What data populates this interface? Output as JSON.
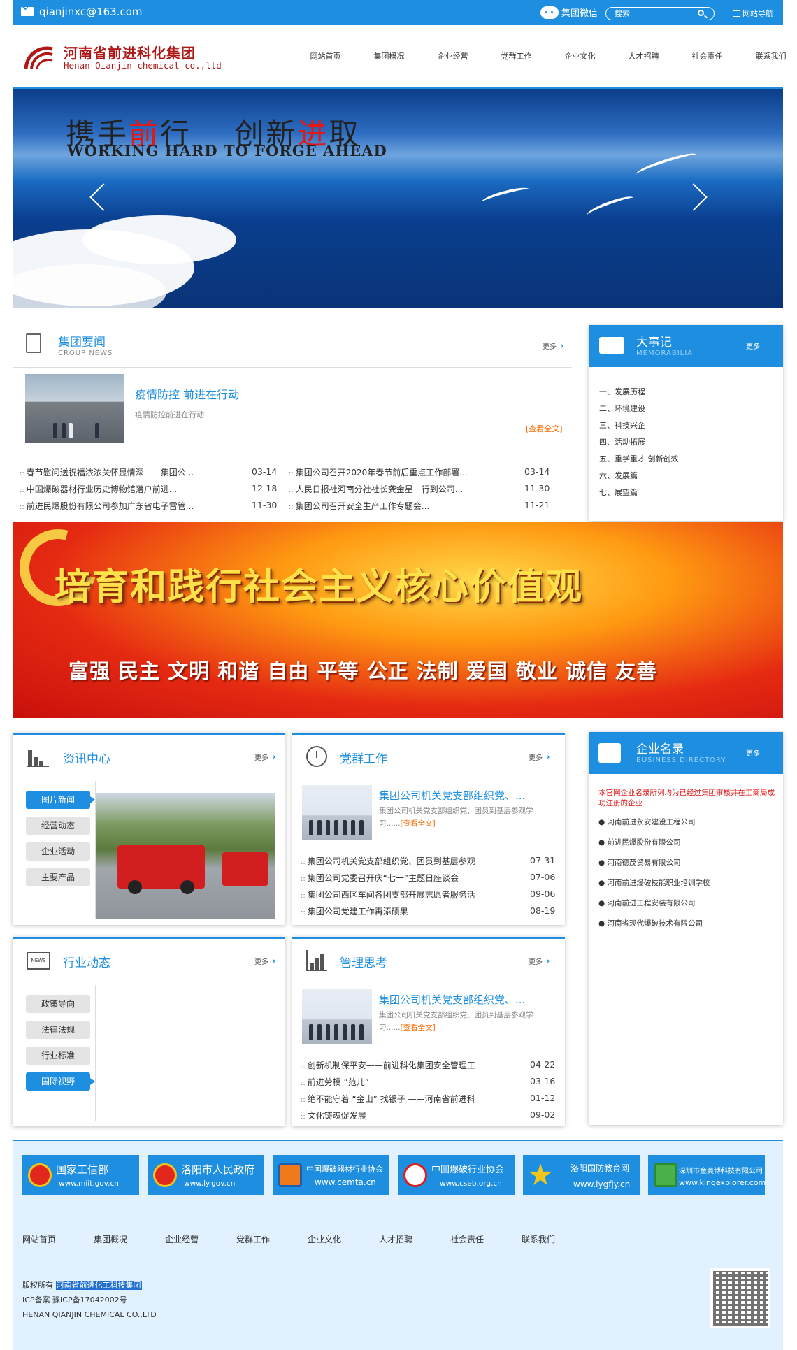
{
  "topbar": {
    "email": "qianjinxc@163.com",
    "wechat_label": "集团微信",
    "search_placeholder": "搜索",
    "site_nav": "网站导航"
  },
  "header": {
    "company_cn": "河南省前进科化集团",
    "company_en": "Henan Qianjin chemical co.,ltd",
    "nav": [
      "网站首页",
      "集团概况",
      "企业经营",
      "党群工作",
      "企业文化",
      "人才招聘",
      "社会责任",
      "联系我们"
    ]
  },
  "banner": {
    "slogan_a": "携手",
    "slogan_b": "前",
    "slogan_c": "行　 创新",
    "slogan_d": "进",
    "slogan_e": "取",
    "slogan_en": "WORKING HARD TO FORGE AHEAD"
  },
  "group_news": {
    "title": "集团要闻",
    "subtitle": "CROUP NEWS",
    "more": "更多",
    "featured_title": "疫情防控 前进在行动",
    "featured_desc": "疫情防控前进在行动",
    "read_all": "[查看全文]",
    "left_items": [
      {
        "text": "春节慰问送祝福浓浓关怀显情深——集团公...",
        "date": "03-14"
      },
      {
        "text": "中国爆破器材行业历史博物馆落户前进...",
        "date": "12-18"
      },
      {
        "text": "前进民爆股份有限公司参加广东省电子雷管...",
        "date": "11-30"
      }
    ],
    "right_items": [
      {
        "text": "集团公司召开2020年春节前后重点工作部署...",
        "date": "03-14"
      },
      {
        "text": "人民日报社河南分社社长龚金星一行到公司...",
        "date": "11-30"
      },
      {
        "text": "集团公司召开安全生产工作专题会...",
        "date": "11-21"
      }
    ]
  },
  "memorabilia": {
    "title": "大事记",
    "subtitle": "MEMORABILIA",
    "more": "更多",
    "items": [
      "一、发展历程",
      "二、环境建设",
      "三、科技兴企",
      "四、活动拓展",
      "五、重学重才 创新创效",
      "六、发展篇",
      "七、展望篇"
    ]
  },
  "values_banner": {
    "title": "培育和践行社会主义核心价值观",
    "values": "富强 民主 文明 和谐 自由 平等 公正 法制 爱国 敬业 诚信 友善"
  },
  "info_center": {
    "title": "资讯中心",
    "more": "更多",
    "tabs": [
      "图片新闻",
      "经营动态",
      "企业活动",
      "主要产品"
    ]
  },
  "party_work": {
    "title": "党群工作",
    "more": "更多",
    "featured_title": "集团公司机关党支部组织党、...",
    "featured_desc": "集团公司机关党支部组织党、团员到基层参观学习......",
    "read_all": "[查看全文]",
    "items": [
      {
        "text": "集团公司机关党支部组织党、团员到基层参观",
        "date": "07-31"
      },
      {
        "text": "集团公司党委召开庆“七一”主题日座谈会",
        "date": "07-06"
      },
      {
        "text": "集团公司西区车间各团支部开展志愿者服务活",
        "date": "09-06"
      },
      {
        "text": "集团公司党建工作再添硕果",
        "date": "08-19"
      }
    ]
  },
  "directory": {
    "title": "企业名录",
    "subtitle": "BUSINESS DIRECTORY",
    "more": "更多",
    "notice": "本官网企业名录所列均为已经过集团审核并在工商局成功注册的企业",
    "items": [
      "河南前进永安建设工程公司",
      "前进民爆股份有限公司",
      "河南德茂贸易有限公司",
      "河南前进爆破技能职业培训学校",
      "河南前进工程安装有限公司",
      "河南省现代爆破技术有限公司"
    ]
  },
  "industry": {
    "title": "行业动态",
    "more": "更多",
    "tabs": [
      "政策导向",
      "法律法规",
      "行业标准",
      "国际视野"
    ],
    "news_label": "NEWS"
  },
  "management": {
    "title": "管理思考",
    "more": "更多",
    "featured_title": "集团公司机关党支部组织党、...",
    "featured_desc": "集团公司机关党支部组织党、团员到基层参观学习......",
    "read_all": "[查看全文]",
    "items": [
      {
        "text": "创新机制保平安——前进科化集团安全管理工",
        "date": "04-22"
      },
      {
        "text": "前进劳模 “范儿”",
        "date": "03-16"
      },
      {
        "text": "绝不能守着 “金山” 找银子 ——河南省前进科",
        "date": "01-12"
      },
      {
        "text": "文化铸魂促发展",
        "date": "09-02"
      }
    ]
  },
  "footer": {
    "links": [
      {
        "name": "国家工信部",
        "url": "www.miit.gov.cn"
      },
      {
        "name": "洛阳市人民政府",
        "url": "www.ly.gov.cn"
      },
      {
        "name": "中国爆破器材行业协会",
        "url": "www.cemta.cn"
      },
      {
        "name": "中国爆破行业协会",
        "url": "www.cseb.org.cn"
      },
      {
        "name": "洛阳国防教育网",
        "url": "www.lygfjy.cn"
      },
      {
        "name": "深圳市金奥博科技有限公司",
        "url": "www.kingexplorer.com"
      }
    ],
    "nav": [
      "网站首页",
      "集团概况",
      "企业经营",
      "党群工作",
      "企业文化",
      "人才招聘",
      "社会责任",
      "联系我们"
    ],
    "copyright_label": "版权所有",
    "copyright_owner": "河南省前进化工科技集团",
    "icp": "ICP备案 豫ICP备17042002号",
    "company_en": "HENAN QIANJIN CHEMICAL CO.,LTD"
  },
  "colors": {
    "primary": "#1e8fe0",
    "brand_red": "#b01818",
    "accent_orange": "#ff6a00"
  }
}
